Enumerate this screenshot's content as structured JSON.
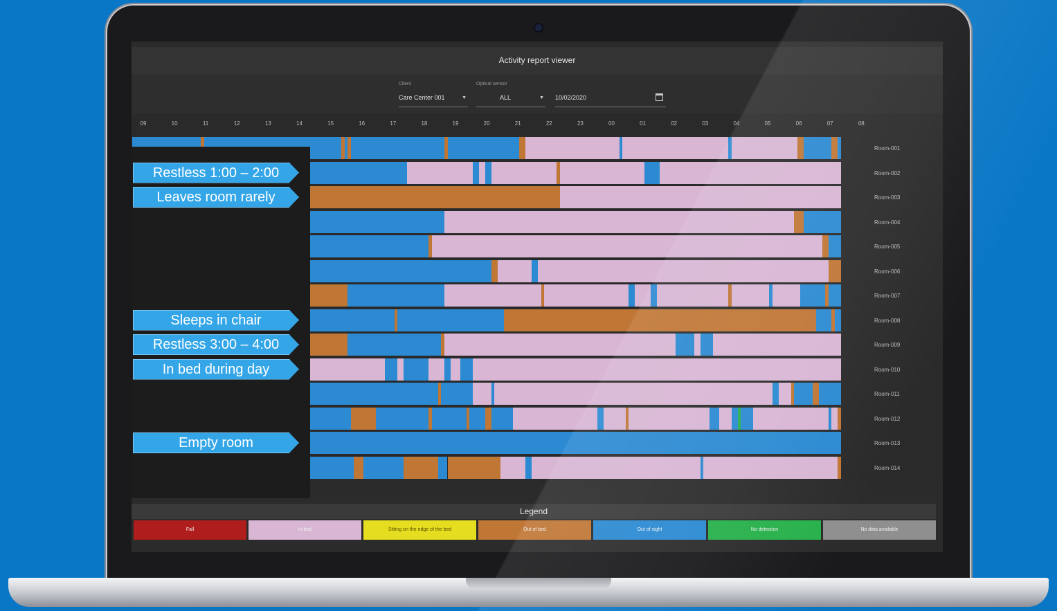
{
  "window": {
    "title": "Activity report viewer"
  },
  "filters": {
    "client_label": "Client",
    "client_value": "Care Center 001",
    "sensor_label": "Optical sensor",
    "sensor_value": "ALL",
    "date_value": "10/02/2020"
  },
  "hours": [
    "09",
    "10",
    "11",
    "12",
    "13",
    "14",
    "15",
    "16",
    "17",
    "18",
    "19",
    "20",
    "21",
    "22",
    "23",
    "00",
    "01",
    "02",
    "03",
    "04",
    "05",
    "06",
    "07",
    "08"
  ],
  "colors": {
    "in_bed": "#d8b6d4",
    "out_of_bed": "#c07635",
    "out_of_sight": "#2b8ad2",
    "fall": "#b01d1d",
    "edge": "#e4dd20",
    "no_detection": "#28b14c",
    "no_data": "#8f8f8f"
  },
  "rooms": [
    "Room-001",
    "Room-002",
    "Room-003",
    "Room-004",
    "Room-005",
    "Room-006",
    "Room-007",
    "Room-008",
    "Room-009",
    "Room-010",
    "Room-011",
    "Room-012",
    "Room-013",
    "Room-014"
  ],
  "callouts": [
    {
      "text": "Restless 1:00 – 2:00",
      "row": 1
    },
    {
      "text": "Leaves room rarely",
      "row": 2
    },
    {
      "text": "Sleeps in chair",
      "row": 7
    },
    {
      "text": "Restless 3:00 – 4:00",
      "row": 8
    },
    {
      "text": "In bed during day",
      "row": 9
    },
    {
      "text": "Empty room",
      "row": 12
    }
  ],
  "legend": {
    "title": "Legend",
    "items": [
      {
        "label": "Fall",
        "color": "#b01d1d"
      },
      {
        "label": "In bed",
        "color": "#d8b6d4"
      },
      {
        "label": "Sitting on the edge of the bed",
        "color": "#e4dd20"
      },
      {
        "label": "Out of bed",
        "color": "#c07635"
      },
      {
        "label": "Out of sight",
        "color": "#2b8ad2"
      },
      {
        "label": "No detection",
        "color": "#28b14c"
      },
      {
        "label": "No data available",
        "color": "#8f8f8f"
      }
    ]
  },
  "timeline": [
    [
      [
        "S",
        9,
        11.2
      ],
      [
        "O",
        11.2,
        11.3
      ],
      [
        "S",
        11.3,
        15.7
      ],
      [
        "O",
        15.7,
        15.8
      ],
      [
        "S",
        15.8,
        15.9
      ],
      [
        "O",
        15.9,
        16.0
      ],
      [
        "S",
        16.0,
        19.0
      ],
      [
        "O",
        19.0,
        19.1
      ],
      [
        "S",
        19.1,
        21.4
      ],
      [
        "O",
        21.4,
        21.6
      ],
      [
        "B",
        21.6,
        24.6
      ],
      [
        "S",
        24.6,
        24.7
      ],
      [
        "B",
        24.7,
        28.1
      ],
      [
        "S",
        28.1,
        28.2
      ],
      [
        "B",
        28.2,
        30.3
      ],
      [
        "O",
        30.3,
        30.5
      ],
      [
        "S",
        30.5,
        31.4
      ],
      [
        "O",
        31.4,
        31.6
      ],
      [
        "S",
        31.6,
        31.7
      ]
    ],
    [
      [
        "S",
        9,
        17.8
      ],
      [
        "B",
        17.8,
        19.9
      ],
      [
        "S",
        19.9,
        20.1
      ],
      [
        "B",
        20.1,
        20.3
      ],
      [
        "S",
        20.3,
        20.5
      ],
      [
        "B",
        20.5,
        22.6
      ],
      [
        "O",
        22.6,
        22.7
      ],
      [
        "B",
        22.7,
        25.4
      ],
      [
        "S",
        25.4,
        25.9
      ],
      [
        "B",
        25.9,
        31.7
      ]
    ],
    [
      [
        "O",
        9,
        22.7
      ],
      [
        "B",
        22.7,
        31.7
      ]
    ],
    [
      [
        "S",
        9,
        19.0
      ],
      [
        "B",
        19.0,
        30.2
      ],
      [
        "O",
        30.2,
        30.5
      ],
      [
        "S",
        30.5,
        31.7
      ]
    ],
    [
      [
        "S",
        9,
        18.5
      ],
      [
        "O",
        18.5,
        18.6
      ],
      [
        "B",
        18.6,
        31.1
      ],
      [
        "O",
        31.1,
        31.3
      ],
      [
        "S",
        31.3,
        31.7
      ]
    ],
    [
      [
        "S",
        9,
        20.5
      ],
      [
        "O",
        20.5,
        20.7
      ],
      [
        "B",
        20.7,
        21.8
      ],
      [
        "S",
        21.8,
        22.0
      ],
      [
        "B",
        22.0,
        31.3
      ],
      [
        "O",
        31.3,
        31.7
      ]
    ],
    [
      [
        "O",
        9,
        15.9
      ],
      [
        "S",
        15.9,
        19.0
      ],
      [
        "B",
        19.0,
        22.1
      ],
      [
        "O",
        22.1,
        22.2
      ],
      [
        "B",
        22.2,
        24.9
      ],
      [
        "S",
        24.9,
        25.1
      ],
      [
        "B",
        25.1,
        25.6
      ],
      [
        "S",
        25.6,
        25.8
      ],
      [
        "B",
        25.8,
        28.1
      ],
      [
        "O",
        28.1,
        28.2
      ],
      [
        "B",
        28.2,
        29.4
      ],
      [
        "S",
        29.4,
        29.5
      ],
      [
        "B",
        29.5,
        30.4
      ],
      [
        "S",
        30.4,
        31.2
      ],
      [
        "O",
        31.2,
        31.3
      ],
      [
        "S",
        31.3,
        31.7
      ]
    ],
    [
      [
        "S",
        9,
        17.4
      ],
      [
        "O",
        17.4,
        17.5
      ],
      [
        "S",
        17.5,
        20.9
      ],
      [
        "O",
        20.9,
        30.9
      ],
      [
        "S",
        30.9,
        31.4
      ],
      [
        "O",
        31.4,
        31.5
      ],
      [
        "S",
        31.5,
        31.7
      ]
    ],
    [
      [
        "O",
        9,
        15.9
      ],
      [
        "S",
        15.9,
        18.9
      ],
      [
        "O",
        18.9,
        19.0
      ],
      [
        "B",
        19.0,
        26.4
      ],
      [
        "S",
        26.4,
        27.0
      ],
      [
        "B",
        27.0,
        27.2
      ],
      [
        "S",
        27.2,
        27.6
      ],
      [
        "B",
        27.6,
        31.7
      ]
    ],
    [
      [
        "B",
        9,
        17.1
      ],
      [
        "S",
        17.1,
        17.5
      ],
      [
        "B",
        17.5,
        17.7
      ],
      [
        "S",
        17.7,
        18.5
      ],
      [
        "B",
        18.5,
        19.0
      ],
      [
        "S",
        19.0,
        19.2
      ],
      [
        "B",
        19.2,
        19.5
      ],
      [
        "S",
        19.5,
        19.9
      ],
      [
        "B",
        19.9,
        31.7
      ]
    ],
    [
      [
        "S",
        9,
        18.8
      ],
      [
        "O",
        18.8,
        18.9
      ],
      [
        "S",
        18.9,
        19.9
      ],
      [
        "B",
        19.9,
        20.5
      ],
      [
        "S",
        20.5,
        20.6
      ],
      [
        "B",
        20.6,
        29.5
      ],
      [
        "S",
        29.5,
        29.7
      ],
      [
        "B",
        29.7,
        30.1
      ],
      [
        "O",
        30.1,
        30.2
      ],
      [
        "S",
        30.2,
        30.8
      ],
      [
        "O",
        30.8,
        31.0
      ],
      [
        "S",
        31.0,
        31.7
      ]
    ],
    [
      [
        "S",
        9,
        16.0
      ],
      [
        "O",
        16.0,
        16.8
      ],
      [
        "S",
        16.8,
        18.5
      ],
      [
        "O",
        18.5,
        18.6
      ],
      [
        "S",
        18.6,
        19.7
      ],
      [
        "O",
        19.7,
        19.8
      ],
      [
        "S",
        19.8,
        20.3
      ],
      [
        "O",
        20.3,
        20.5
      ],
      [
        "S",
        20.5,
        21.2
      ],
      [
        "B",
        21.2,
        23.9
      ],
      [
        "S",
        23.9,
        24.1
      ],
      [
        "B",
        24.1,
        24.8
      ],
      [
        "O",
        24.8,
        24.9
      ],
      [
        "B",
        24.9,
        27.5
      ],
      [
        "S",
        27.5,
        27.8
      ],
      [
        "B",
        27.8,
        28.2
      ],
      [
        "S",
        28.2,
        28.4
      ],
      [
        "N",
        28.4,
        28.5
      ],
      [
        "S",
        28.5,
        28.9
      ],
      [
        "B",
        28.9,
        31.3
      ],
      [
        "S",
        31.3,
        31.4
      ],
      [
        "B",
        31.4,
        31.6
      ],
      [
        "O",
        31.6,
        31.7
      ]
    ],
    [
      [
        "S",
        9,
        31.7
      ]
    ],
    [
      [
        "S",
        9,
        16.1
      ],
      [
        "O",
        16.1,
        16.4
      ],
      [
        "S",
        16.4,
        17.7
      ],
      [
        "O",
        17.7,
        18.8
      ],
      [
        "S",
        18.8,
        19.1
      ],
      [
        "O",
        19.1,
        20.8
      ],
      [
        "B",
        20.8,
        21.6
      ],
      [
        "S",
        21.6,
        21.8
      ],
      [
        "B",
        21.8,
        27.2
      ],
      [
        "S",
        27.2,
        27.3
      ],
      [
        "B",
        27.3,
        31.6
      ],
      [
        "O",
        31.6,
        31.7
      ]
    ]
  ]
}
